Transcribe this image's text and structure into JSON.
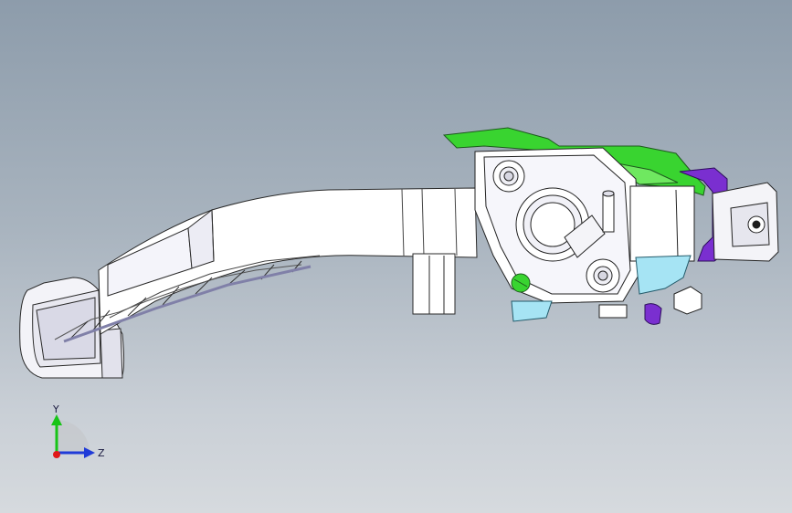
{
  "viewport": {
    "background_top": "#8d9cab",
    "background_bottom": "#d6dade"
  },
  "model": {
    "part_colors": {
      "pedal_body": "#ffffff",
      "bracket_green": "#39d430",
      "bracket_purple": "#7a2fd0",
      "bracket_cyan": "#a6e4f4",
      "pedal_pad": "#f1f1f6",
      "lines": "#1f1f1f"
    }
  },
  "triad": {
    "y_label": "Y",
    "z_label": "Z",
    "y_color": "#17c417",
    "z_color": "#1f3bd8",
    "x_color": "#e01818"
  }
}
